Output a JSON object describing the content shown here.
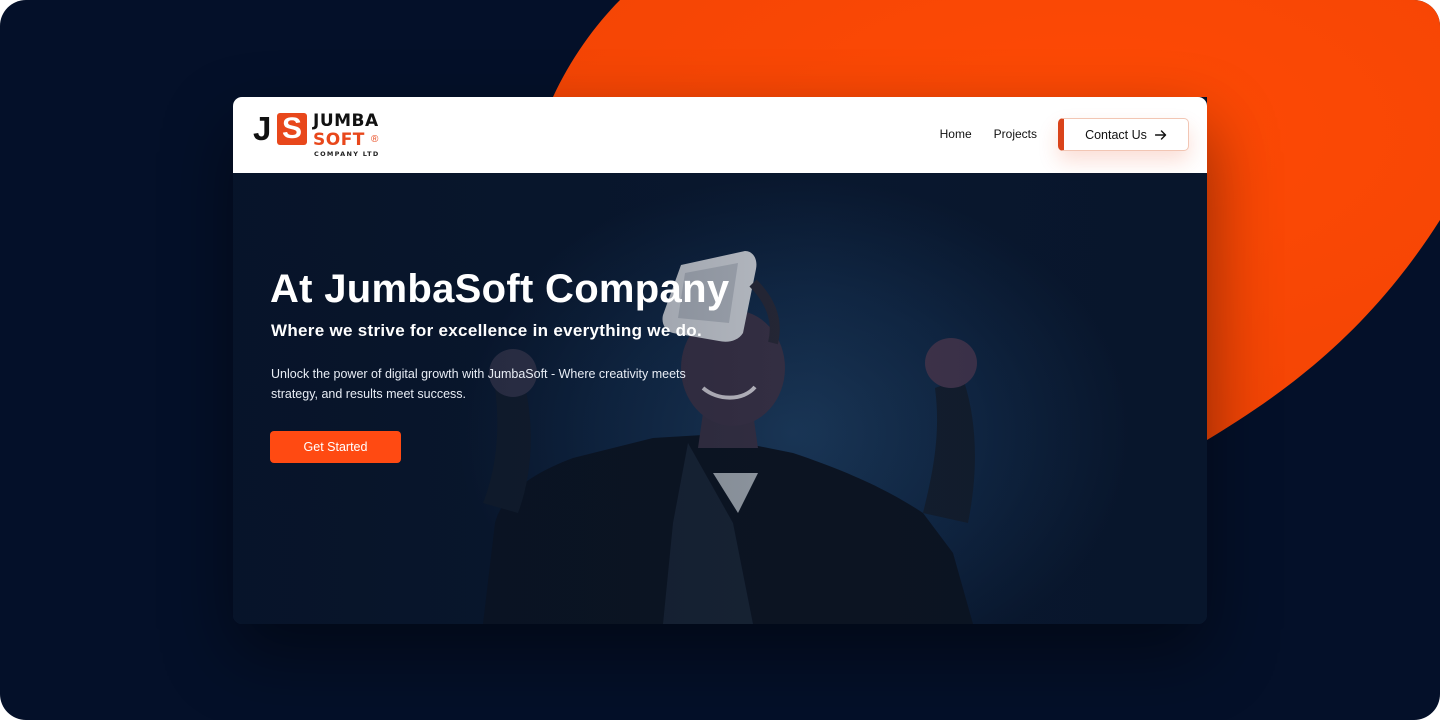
{
  "brand": {
    "mark_j": "J",
    "mark_s": "S",
    "name_line1": "JUMBA",
    "name_line2": "SOFT",
    "registered": "®",
    "tagline": "COMPANY LTD"
  },
  "nav": {
    "links": [
      {
        "label": "Home"
      },
      {
        "label": "Projects"
      }
    ],
    "contact_label": "Contact Us"
  },
  "hero": {
    "title": "At JumbaSoft Company",
    "subtitle": "Where we strive for excellence in everything we do.",
    "body": "Unlock the power of digital growth with JumbaSoft - Where creativity meets strategy, and results meet success.",
    "cta_label": "Get Started"
  },
  "colors": {
    "background": "#041029",
    "accent": "#ff4a12",
    "navbar": "#ffffff"
  },
  "icons": {
    "contact_arrow": "arrow-right-icon"
  }
}
